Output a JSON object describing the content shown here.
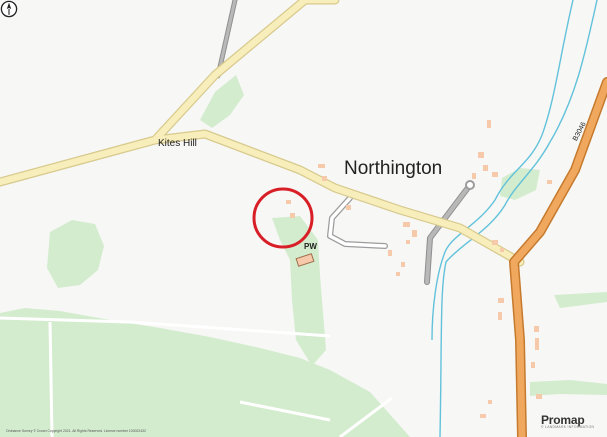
{
  "map": {
    "place_name": "Northington",
    "hill_name": "Kites Hill",
    "worship_label": "PW",
    "road_number": "B3046",
    "copyright": "Ordnance Survey © Crown Copyright 2021. All Rights Reserved. Licence number 100022432",
    "brand": {
      "name": "Promap",
      "tagline": "© LANDMARK INFORMATION"
    },
    "colors": {
      "background": "#f7f7f5",
      "woodland": "#d3ecce",
      "minor_road": "#f7eebb",
      "minor_road_casing": "#d8ca8d",
      "b_road": "#f0a85e",
      "b_road_casing": "#c57a2e",
      "track": "#a3a3a3",
      "river": "#62c2db",
      "building": "#f5c9a9",
      "marker": "#d81e26"
    },
    "icons": [
      "north-arrow-icon",
      "location-circle-icon"
    ]
  }
}
